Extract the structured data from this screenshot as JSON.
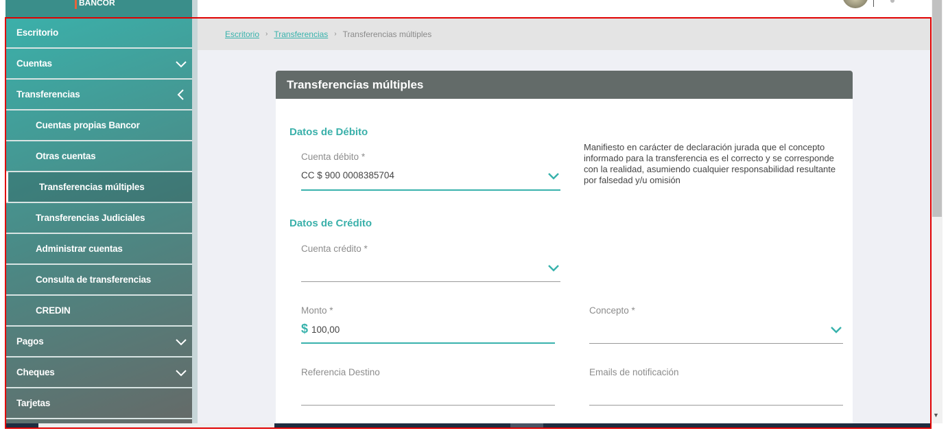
{
  "logo": "BANCOR",
  "sidebar": {
    "items": [
      {
        "label": "Escritorio"
      },
      {
        "label": "Cuentas"
      },
      {
        "label": "Transferencias"
      },
      {
        "label": "Cuentas propias Bancor"
      },
      {
        "label": "Otras cuentas"
      },
      {
        "label": "Transferencias múltiples"
      },
      {
        "label": "Transferencias Judiciales"
      },
      {
        "label": "Administrar cuentas"
      },
      {
        "label": "Consulta de transferencias"
      },
      {
        "label": "CREDIN"
      },
      {
        "label": "Pagos"
      },
      {
        "label": "Cheques"
      },
      {
        "label": "Tarjetas"
      }
    ]
  },
  "breadcrumb": {
    "home": "Escritorio",
    "parent": "Transferencias",
    "current": "Transferencias múltiples",
    "sep": "›"
  },
  "card": {
    "title": "Transferencias múltiples",
    "debit_section": "Datos de Débito",
    "debit_label": "Cuenta débito *",
    "debit_value": "CC $ 900 0008385704",
    "declaration": "Manifiesto en carácter de declaración jurada que el concepto informado para la transferencia es el correcto y se corresponde con la realidad, asumiendo cualquier responsabilidad resultante por falsedad y/u omisión",
    "credit_section": "Datos de Crédito",
    "credit_label": "Cuenta crédito *",
    "amount_label": "Monto *",
    "currency": "$",
    "amount_value": "100,00",
    "concept_label": "Concepto *",
    "reference_label": "Referencia Destino",
    "emails_label": "Emails de notificación"
  },
  "colors": {
    "accent": "#38b2ac",
    "header": "#636b69"
  }
}
